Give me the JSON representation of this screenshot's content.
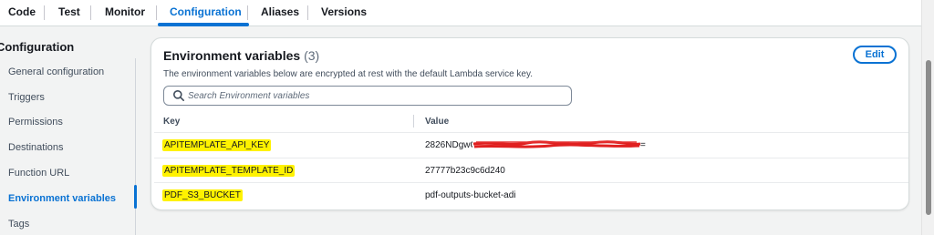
{
  "tabs": [
    {
      "label": "Code"
    },
    {
      "label": "Test"
    },
    {
      "label": "Monitor"
    },
    {
      "label": "Configuration",
      "active": true
    },
    {
      "label": "Aliases"
    },
    {
      "label": "Versions"
    }
  ],
  "sidebar": {
    "title": "Configuration",
    "items": [
      {
        "label": "General configuration"
      },
      {
        "label": "Triggers"
      },
      {
        "label": "Permissions"
      },
      {
        "label": "Destinations"
      },
      {
        "label": "Function URL"
      },
      {
        "label": "Environment variables",
        "active": true
      },
      {
        "label": "Tags"
      }
    ]
  },
  "env": {
    "title": "Environment variables",
    "count": "(3)",
    "description": "The environment variables below are encrypted at rest with the default Lambda service key.",
    "edit_label": "Edit",
    "search_placeholder": "Search Environment variables",
    "columns": {
      "key": "Key",
      "value": "Value"
    },
    "rows": [
      {
        "key": "APITEMPLATE_API_KEY",
        "value": "2826NDgwODI6N",
        "value_tail": "=",
        "redacted": true
      },
      {
        "key": "APITEMPLATE_TEMPLATE_ID",
        "value": "27777b23c9c6d240"
      },
      {
        "key": "PDF_S3_BUCKET",
        "value": "pdf-outputs-bucket-adi"
      }
    ]
  },
  "colors": {
    "accent": "#0972d3",
    "highlight": "#fff200",
    "redaction": "#e02020"
  }
}
